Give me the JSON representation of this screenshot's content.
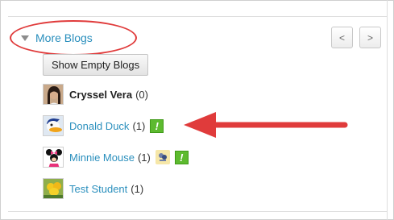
{
  "header": {
    "title": "More Blogs"
  },
  "pager": {
    "prev": "<",
    "next": ">"
  },
  "show_empty": {
    "label": "Show Empty Blogs"
  },
  "blogs": [
    {
      "name": "Cryssel Vera",
      "count": "(0)"
    },
    {
      "name": "Donald Duck",
      "count": "(1)",
      "badge": "!"
    },
    {
      "name": "Minnie Mouse",
      "count": "(1)",
      "badge": "!"
    },
    {
      "name": "Test Student",
      "count": "(1)"
    }
  ],
  "colors": {
    "link": "#2a8fbd",
    "annotation": "#e03b3b",
    "badge": "#5dba2f"
  }
}
